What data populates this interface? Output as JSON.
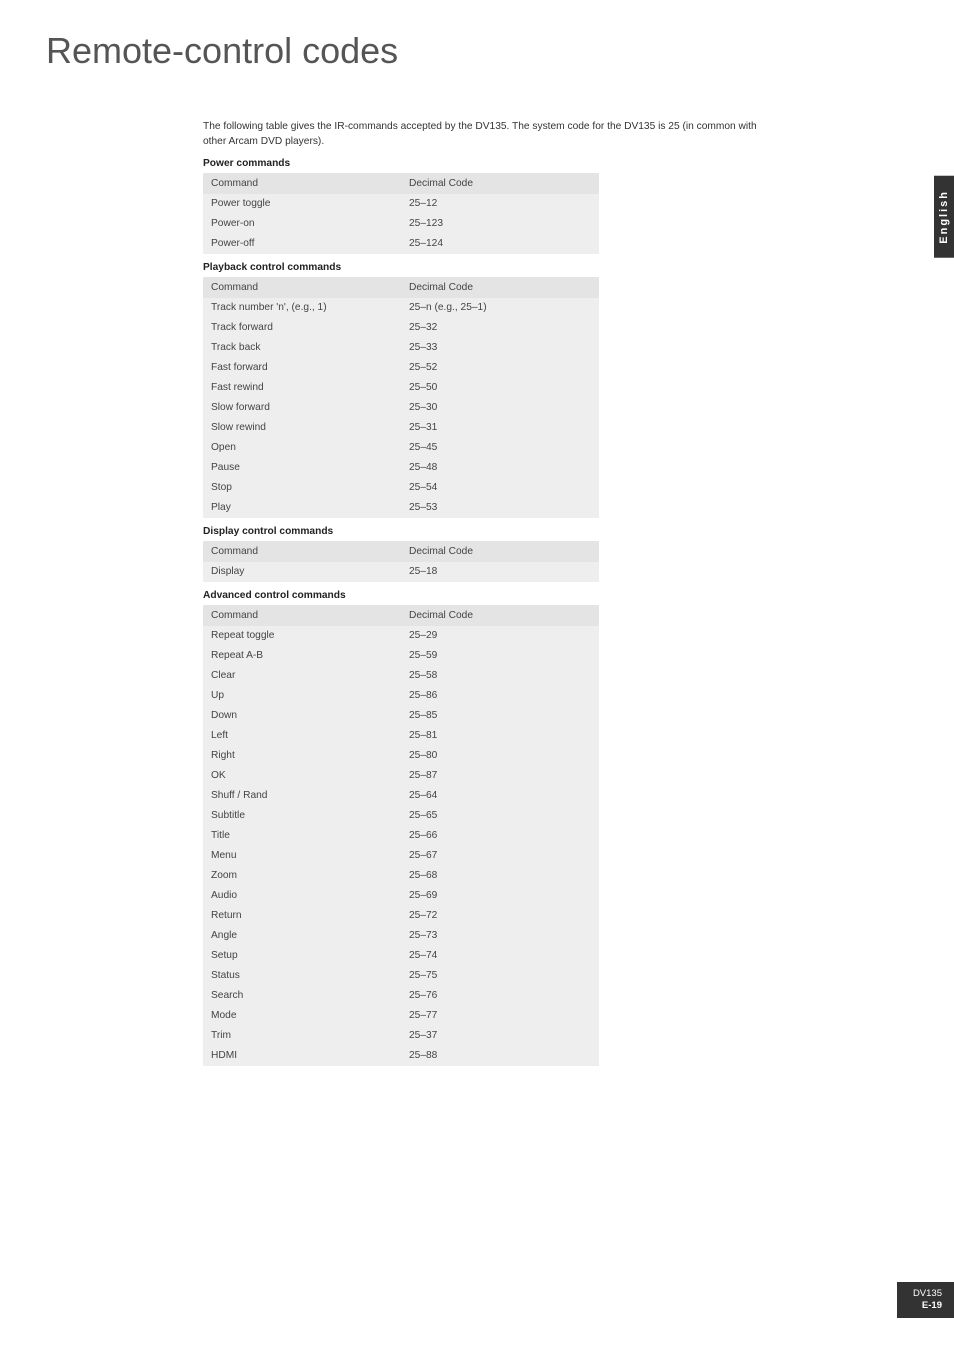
{
  "page": {
    "title": "Remote-control codes",
    "intro": "The following table gives the IR-commands accepted by the DV135. The system code for the DV135 is 25 (in common with other Arcam DVD players).",
    "side_tab": "English",
    "footer_model": "DV135",
    "footer_page": "E-19"
  },
  "sections": [
    {
      "title": "Power commands",
      "header": {
        "c1": "Command",
        "c2": "Decimal Code"
      },
      "rows": [
        {
          "c1": "Power toggle",
          "c2": "25–12"
        },
        {
          "c1": "Power-on",
          "c2": "25–123"
        },
        {
          "c1": "Power-off",
          "c2": "25–124"
        }
      ]
    },
    {
      "title": "Playback control commands",
      "header": {
        "c1": "Command",
        "c2": "Decimal Code"
      },
      "rows": [
        {
          "c1": "Track number 'n', (e.g., 1)",
          "c2": "25–n (e.g., 25–1)"
        },
        {
          "c1": "Track forward",
          "c2": "25–32"
        },
        {
          "c1": "Track back",
          "c2": "25–33"
        },
        {
          "c1": "Fast forward",
          "c2": "25–52"
        },
        {
          "c1": "Fast rewind",
          "c2": "25–50"
        },
        {
          "c1": "Slow forward",
          "c2": "25–30"
        },
        {
          "c1": "Slow rewind",
          "c2": "25–31"
        },
        {
          "c1": "Open",
          "c2": "25–45"
        },
        {
          "c1": "Pause",
          "c2": "25–48"
        },
        {
          "c1": "Stop",
          "c2": "25–54"
        },
        {
          "c1": "Play",
          "c2": "25–53"
        }
      ]
    },
    {
      "title": "Display control commands",
      "header": {
        "c1": "Command",
        "c2": "Decimal Code"
      },
      "rows": [
        {
          "c1": "Display",
          "c2": "25–18"
        }
      ]
    },
    {
      "title": "Advanced control commands",
      "header": {
        "c1": "Command",
        "c2": "Decimal Code"
      },
      "rows": [
        {
          "c1": "Repeat toggle",
          "c2": "25–29"
        },
        {
          "c1": "Repeat A-B",
          "c2": "25–59"
        },
        {
          "c1": "Clear",
          "c2": "25–58"
        },
        {
          "c1": "Up",
          "c2": "25–86"
        },
        {
          "c1": "Down",
          "c2": "25–85"
        },
        {
          "c1": "Left",
          "c2": "25–81"
        },
        {
          "c1": "Right",
          "c2": "25–80"
        },
        {
          "c1": "OK",
          "c2": "25–87"
        },
        {
          "c1": "Shuff / Rand",
          "c2": "25–64"
        },
        {
          "c1": "Subtitle",
          "c2": "25–65"
        },
        {
          "c1": "Title",
          "c2": "25–66"
        },
        {
          "c1": "Menu",
          "c2": "25–67"
        },
        {
          "c1": "Zoom",
          "c2": "25–68"
        },
        {
          "c1": "Audio",
          "c2": "25–69"
        },
        {
          "c1": "Return",
          "c2": "25–72"
        },
        {
          "c1": "Angle",
          "c2": "25–73"
        },
        {
          "c1": "Setup",
          "c2": "25–74"
        },
        {
          "c1": "Status",
          "c2": "25–75"
        },
        {
          "c1": "Search",
          "c2": "25–76"
        },
        {
          "c1": "Mode",
          "c2": "25–77"
        },
        {
          "c1": "Trim",
          "c2": "25–37"
        },
        {
          "c1": "HDMI",
          "c2": "25–88"
        }
      ]
    }
  ]
}
